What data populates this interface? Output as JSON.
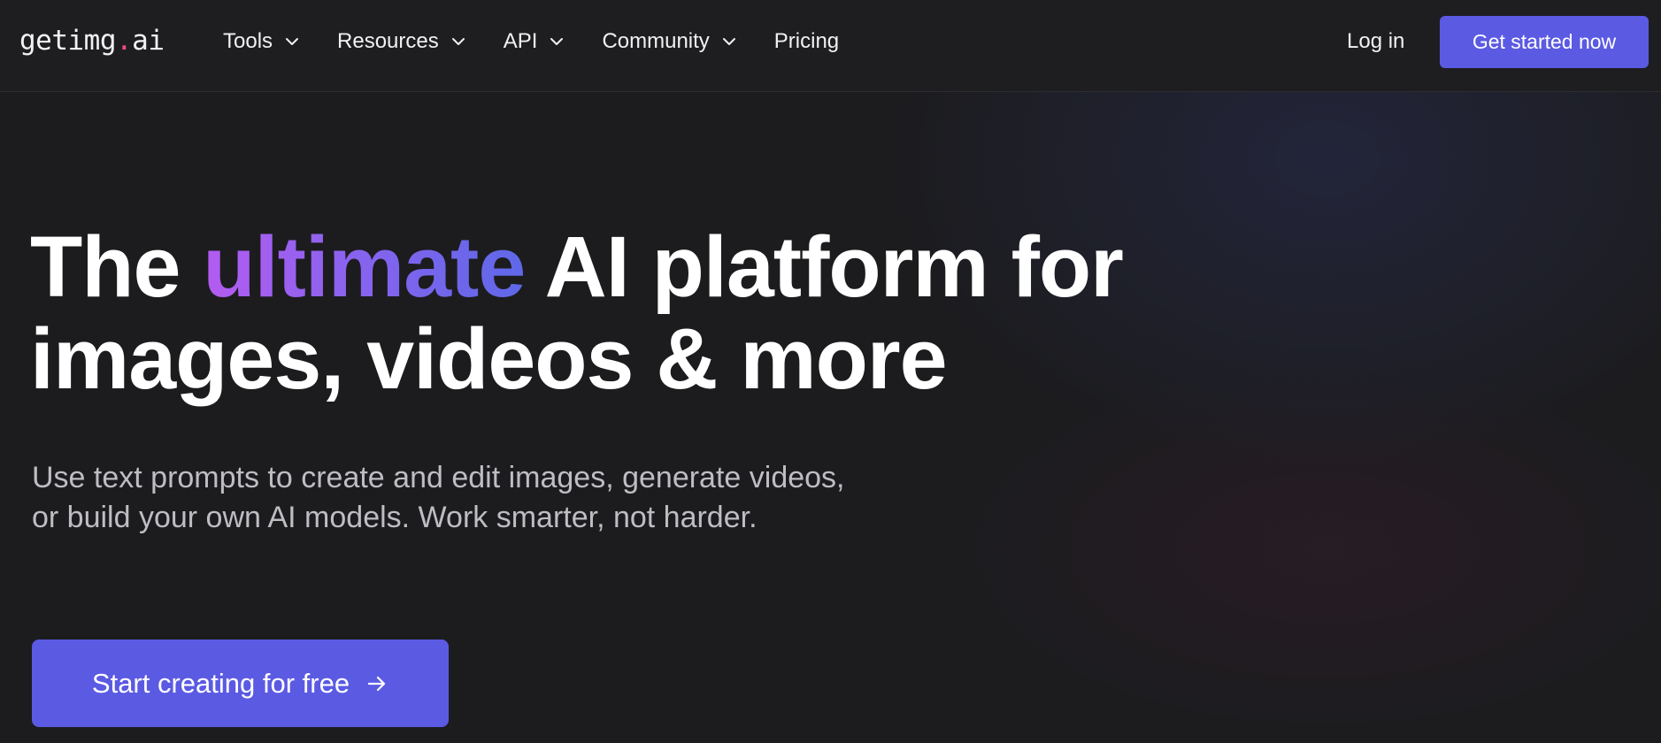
{
  "header": {
    "logo": {
      "prefix": "getimg",
      "dot": ".",
      "suffix": "ai"
    },
    "nav": [
      {
        "label": "Tools",
        "has_dropdown": true,
        "icon": "chevron-down-icon"
      },
      {
        "label": "Resources",
        "has_dropdown": true,
        "icon": "chevron-down-icon"
      },
      {
        "label": "API",
        "has_dropdown": true,
        "icon": "chevron-down-icon"
      },
      {
        "label": "Community",
        "has_dropdown": true,
        "icon": "chevron-down-icon"
      },
      {
        "label": "Pricing",
        "has_dropdown": false
      }
    ],
    "login_label": "Log in",
    "cta_label": "Get started now"
  },
  "hero": {
    "title_before": "The",
    "title_highlight": "ultimate",
    "title_after_line1": "AI platform for",
    "title_line2": "images, videos & more",
    "subtitle": "Use text prompts to create and edit images, generate videos, or build your own AI models. Work smarter, not harder.",
    "cta_label": "Start creating for free",
    "cta_icon": "arrow-right-icon"
  },
  "colors": {
    "background": "#1c1c1f",
    "header_background": "#1e1e21",
    "accent": "#5b5ae3",
    "logo_dot": "#f04e7a",
    "gradient_start": "#b45cf0",
    "gradient_end": "#5e68e8",
    "subtitle_text": "#bdbdc2"
  }
}
